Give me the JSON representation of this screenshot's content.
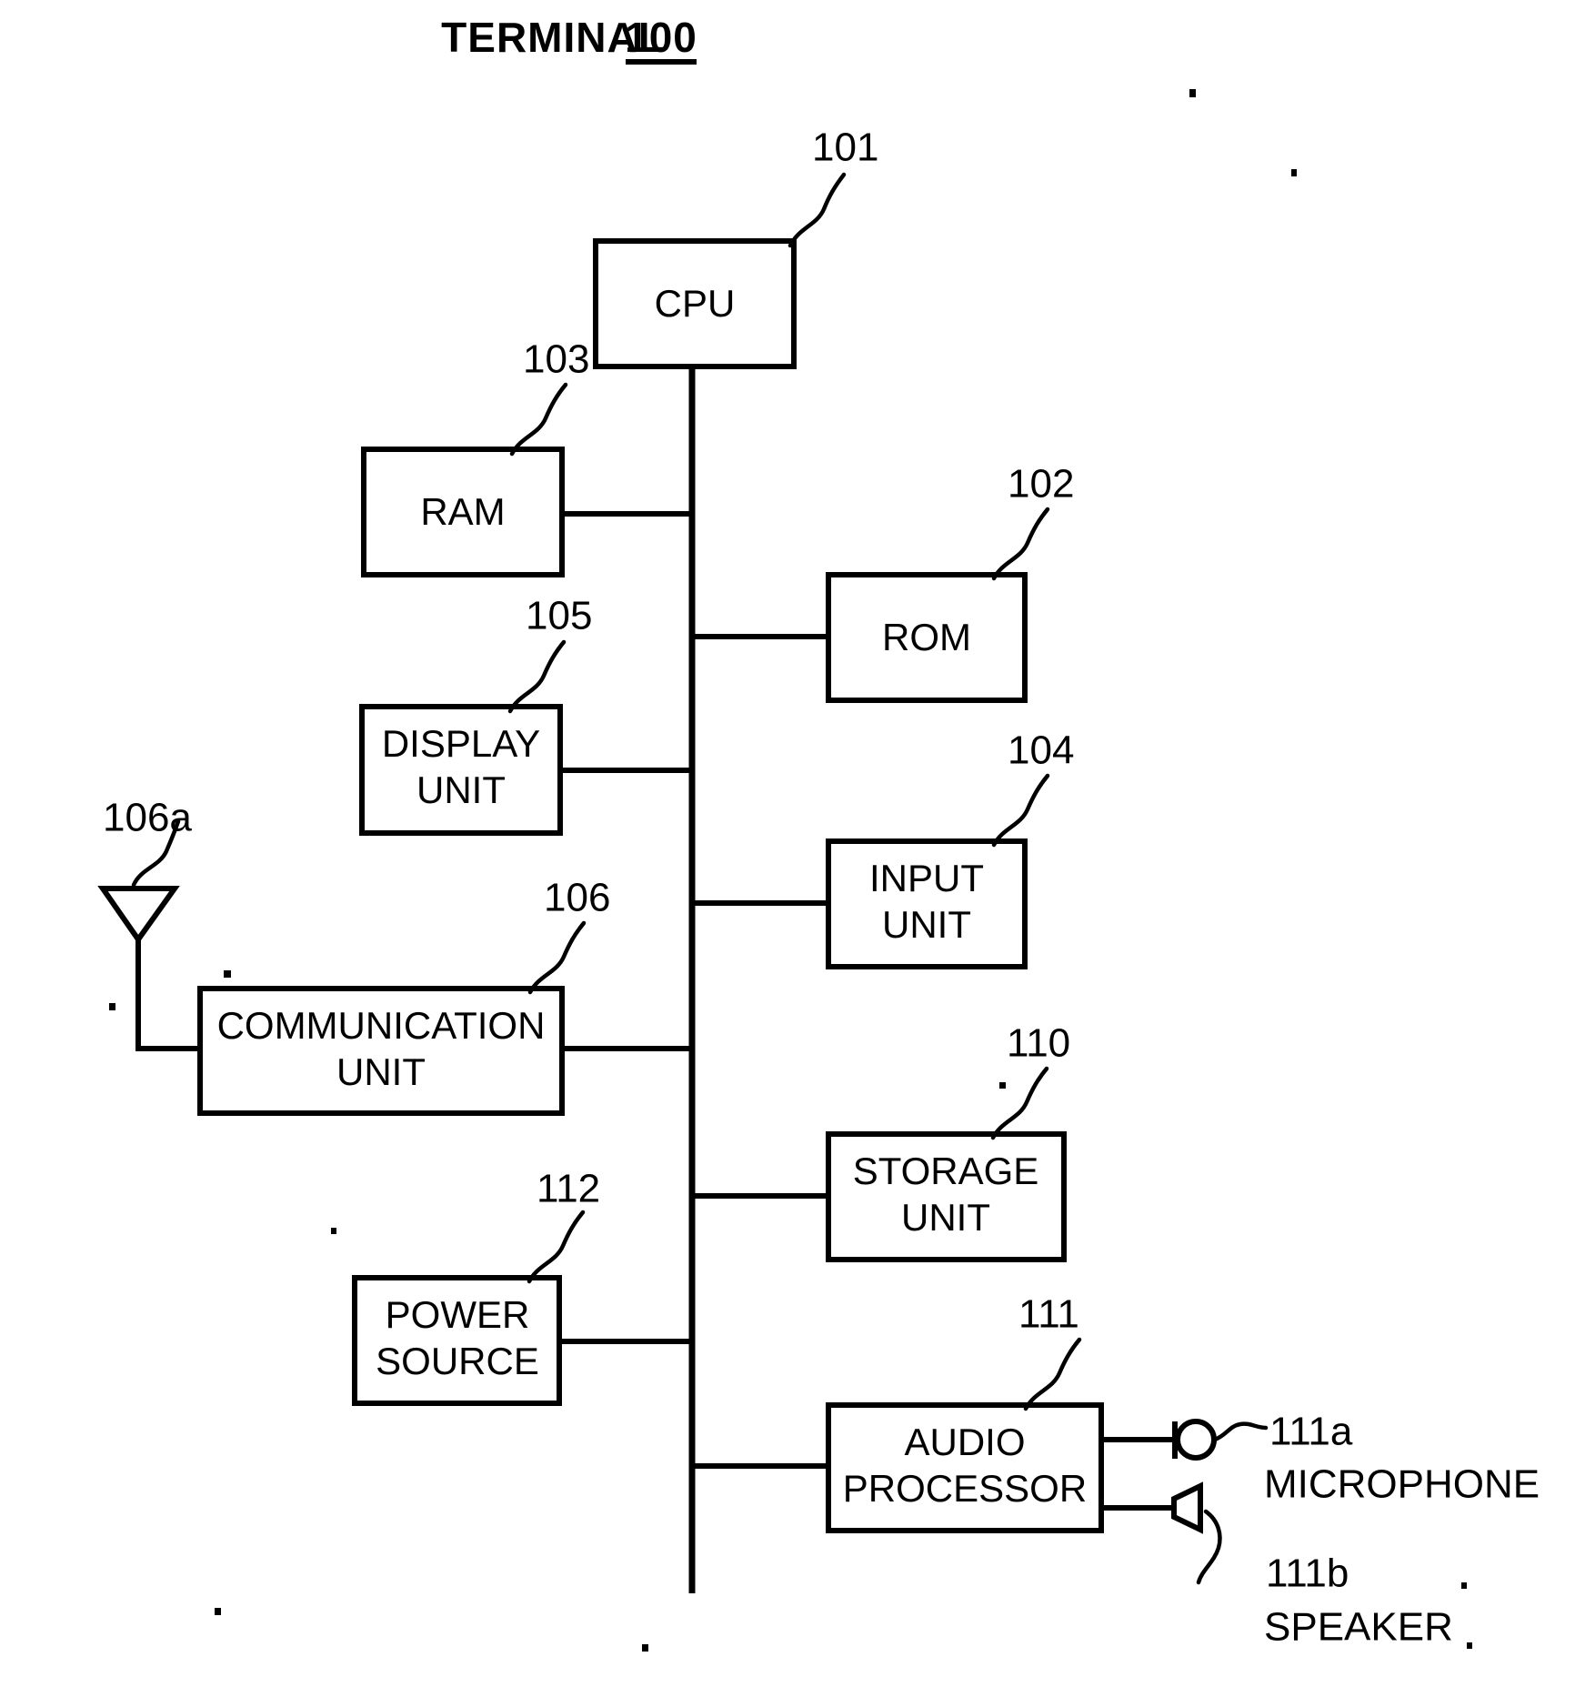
{
  "figure": {
    "title_text": "TERMINAL",
    "title_ref": "100"
  },
  "blocks": [
    {
      "id": "cpu",
      "label_line1": "CPU",
      "label_line2": "",
      "ref": "101"
    },
    {
      "id": "rom",
      "label_line1": "ROM",
      "label_line2": "",
      "ref": "102"
    },
    {
      "id": "ram",
      "label_line1": "RAM",
      "label_line2": "",
      "ref": "103"
    },
    {
      "id": "input-unit",
      "label_line1": "INPUT",
      "label_line2": "UNIT",
      "ref": "104"
    },
    {
      "id": "display-unit",
      "label_line1": "DISPLAY",
      "label_line2": "UNIT",
      "ref": "105"
    },
    {
      "id": "comm-unit",
      "label_line1": "COMMUNICATION",
      "label_line2": "UNIT",
      "ref": "106"
    },
    {
      "id": "storage-unit",
      "label_line1": "STORAGE",
      "label_line2": "UNIT",
      "ref": "110"
    },
    {
      "id": "audio-proc",
      "label_line1": "AUDIO",
      "label_line2": "PROCESSOR",
      "ref": "111"
    },
    {
      "id": "power-source",
      "label_line1": "POWER",
      "label_line2": "SOURCE",
      "ref": "112"
    }
  ],
  "peripherals": [
    {
      "id": "antenna",
      "ref": "106a",
      "label": "",
      "icon": "antenna-icon"
    },
    {
      "id": "microphone",
      "ref": "111a",
      "label": "MICROPHONE",
      "icon": "microphone-icon"
    },
    {
      "id": "speaker",
      "ref": "111b",
      "label": "SPEAKER",
      "icon": "speaker-icon"
    }
  ],
  "colors": {
    "line": "#000000",
    "background": "#ffffff",
    "fill": "#ffffff"
  }
}
